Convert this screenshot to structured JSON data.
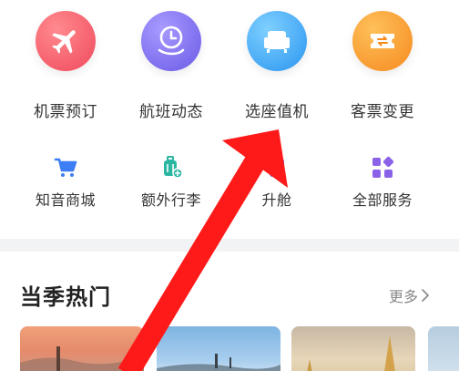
{
  "primary_services": [
    {
      "label": "机票预订",
      "icon": "airplane-icon",
      "color": "#f25c6a"
    },
    {
      "label": "航班动态",
      "icon": "clock-hand-icon",
      "color": "#7a6cf0"
    },
    {
      "label": "选座值机",
      "icon": "seat-icon",
      "color": "#3aa7f5"
    },
    {
      "label": "客票变更",
      "icon": "ticket-exchange-icon",
      "color": "#f79a2e"
    }
  ],
  "secondary_services": [
    {
      "label": "知音商城",
      "icon": "cart-icon",
      "color": "#3d7ef5"
    },
    {
      "label": "额外行李",
      "icon": "luggage-icon",
      "color": "#2bb6a2"
    },
    {
      "label": "升舱",
      "icon": "upgrade-icon",
      "color": "#4a6cf0"
    },
    {
      "label": "全部服务",
      "icon": "grid-icon",
      "color": "#8a62e8"
    }
  ],
  "section": {
    "title": "当季热门",
    "more_label": "更多"
  },
  "annotation": {
    "color": "#ff1a1a"
  }
}
